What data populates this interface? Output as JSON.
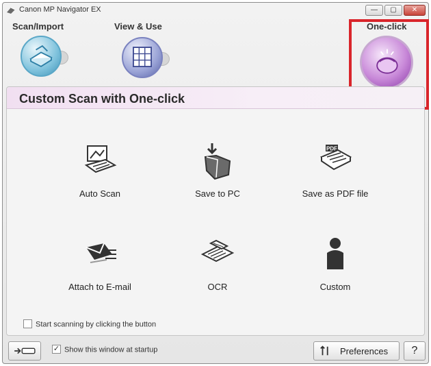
{
  "window": {
    "title": "Canon MP Navigator EX",
    "minimize_label": "—",
    "maximize_label": "▢",
    "close_label": "✕"
  },
  "nav": {
    "scan_import": "Scan/Import",
    "view_use": "View & Use",
    "one_click": "One-click"
  },
  "panel": {
    "title": "Custom Scan with One-click",
    "actions": {
      "auto_scan": "Auto Scan",
      "save_to_pc": "Save to PC",
      "save_as_pdf": "Save as PDF file",
      "attach_email": "Attach to E-mail",
      "ocr": "OCR",
      "custom": "Custom"
    },
    "start_scanning_label": "Start scanning by clicking the button",
    "start_scanning_checked": false
  },
  "footer": {
    "show_window_label": "Show this window at startup",
    "show_window_checked": true,
    "check_mark": "✓",
    "preferences_label": "Preferences",
    "help_label": "?"
  },
  "colors": {
    "accent_purple": "#9c3fb5",
    "header_tint": "#f1dff1",
    "highlight_red": "#d9252b"
  }
}
